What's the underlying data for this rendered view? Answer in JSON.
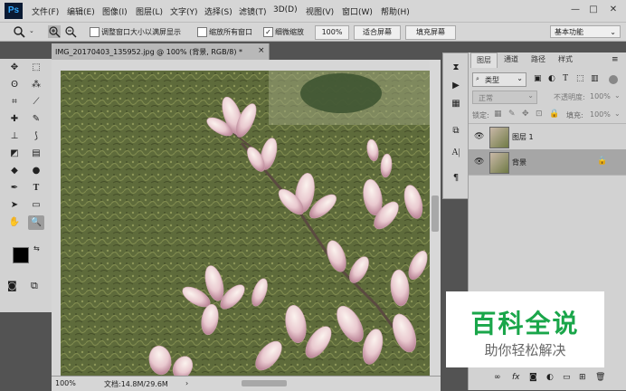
{
  "app": {
    "logo": "Ps"
  },
  "menu": [
    "文件(F)",
    "编辑(E)",
    "图像(I)",
    "图层(L)",
    "文字(Y)",
    "选择(S)",
    "滤镜(T)",
    "3D(D)",
    "视图(V)",
    "窗口(W)",
    "帮助(H)"
  ],
  "window_controls": {
    "min": "—",
    "max": "□",
    "close": "✕"
  },
  "options": {
    "resize_windows": "调整窗口大小以满屏显示",
    "zoom_all": "缩放所有窗口",
    "scrubby_zoom": "细微缩放",
    "zoom_value": "100%",
    "fit_screen": "适合屏幕",
    "fill_screen": "填充屏幕",
    "workspace": "基本功能"
  },
  "document": {
    "tab_title": "IMG_20170403_135952.jpg @ 100% (背景, RGB/8) *",
    "zoom": "100%",
    "doc_size": "文档:14.8M/29.6M"
  },
  "mini_panel_icons": [
    "history-icon",
    "play-icon",
    "brush-settings-icon",
    "clone-source-icon",
    "character-icon",
    "paragraph-icon"
  ],
  "layers_panel": {
    "tabs": [
      "图层",
      "通道",
      "路径",
      "样式"
    ],
    "filter_kind": "类型",
    "blend_mode": "正常",
    "opacity_label": "不透明度:",
    "opacity_value": "100%",
    "lock_label": "锁定:",
    "fill_label": "填充:",
    "fill_value": "100%",
    "layers": [
      {
        "name": "图层 1",
        "selected": false,
        "locked": false
      },
      {
        "name": "背景",
        "selected": true,
        "locked": true
      }
    ],
    "bottom_icons": [
      "link-icon",
      "fx-icon",
      "mask-icon",
      "adjustment-icon",
      "group-icon",
      "new-layer-icon",
      "trash-icon"
    ]
  },
  "watermark": {
    "title": "百科全说",
    "subtitle": "助你轻松解决"
  },
  "colors": {
    "foreground": "#000000",
    "background": "#ffffff",
    "watermark_green": "#1aa64a",
    "ps_blue": "#31a8ff"
  }
}
